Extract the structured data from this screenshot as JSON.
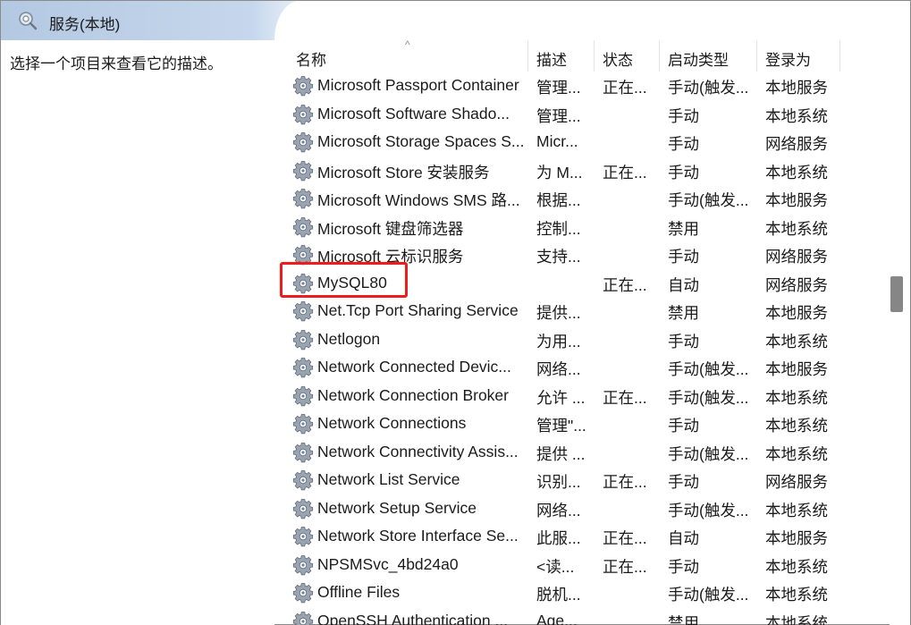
{
  "window": {
    "title": "服务(本地)",
    "title_icon": "services-icon"
  },
  "left_pane": {
    "description_hint": "选择一个项目来查看它的描述。"
  },
  "columns": {
    "name": "名称",
    "description": "描述",
    "status": "状态",
    "startup_type": "启动类型",
    "logon_as": "登录为"
  },
  "services": [
    {
      "name": "Microsoft Passport Container",
      "description": "管理...",
      "status": "正在...",
      "startup_type": "手动(触发...",
      "logon_as": "本地服务"
    },
    {
      "name": "Microsoft Software Shado...",
      "description": "管理...",
      "status": "",
      "startup_type": "手动",
      "logon_as": "本地系统"
    },
    {
      "name": "Microsoft Storage Spaces S...",
      "description": "Micr...",
      "status": "",
      "startup_type": "手动",
      "logon_as": "网络服务"
    },
    {
      "name": "Microsoft Store 安装服务",
      "description": "为 M...",
      "status": "正在...",
      "startup_type": "手动",
      "logon_as": "本地系统"
    },
    {
      "name": "Microsoft Windows SMS 路...",
      "description": "根据...",
      "status": "",
      "startup_type": "手动(触发...",
      "logon_as": "本地服务"
    },
    {
      "name": "Microsoft 键盘筛选器",
      "description": "控制...",
      "status": "",
      "startup_type": "禁用",
      "logon_as": "本地系统"
    },
    {
      "name": "Microsoft 云标识服务",
      "description": "支持...",
      "status": "",
      "startup_type": "手动",
      "logon_as": "网络服务"
    },
    {
      "name": "MySQL80",
      "description": "",
      "status": "正在...",
      "startup_type": "自动",
      "logon_as": "网络服务"
    },
    {
      "name": "Net.Tcp Port Sharing Service",
      "description": "提供...",
      "status": "",
      "startup_type": "禁用",
      "logon_as": "本地服务"
    },
    {
      "name": "Netlogon",
      "description": "为用...",
      "status": "",
      "startup_type": "手动",
      "logon_as": "本地系统"
    },
    {
      "name": "Network Connected Devic...",
      "description": "网络...",
      "status": "",
      "startup_type": "手动(触发...",
      "logon_as": "本地服务"
    },
    {
      "name": "Network Connection Broker",
      "description": "允许 ...",
      "status": "正在...",
      "startup_type": "手动(触发...",
      "logon_as": "本地系统"
    },
    {
      "name": "Network Connections",
      "description": "管理\"...",
      "status": "",
      "startup_type": "手动",
      "logon_as": "本地系统"
    },
    {
      "name": "Network Connectivity Assis...",
      "description": "提供 ...",
      "status": "",
      "startup_type": "手动(触发...",
      "logon_as": "本地系统"
    },
    {
      "name": "Network List Service",
      "description": "识别...",
      "status": "正在...",
      "startup_type": "手动",
      "logon_as": "网络服务"
    },
    {
      "name": "Network Setup Service",
      "description": "网络...",
      "status": "",
      "startup_type": "手动(触发...",
      "logon_as": "本地系统"
    },
    {
      "name": "Network Store Interface Se...",
      "description": "此服...",
      "status": "正在...",
      "startup_type": "自动",
      "logon_as": "本地服务"
    },
    {
      "name": "NPSMSvc_4bd24a0",
      "description": "<读...",
      "status": "正在...",
      "startup_type": "手动",
      "logon_as": "本地系统"
    },
    {
      "name": "Offline Files",
      "description": "脱机...",
      "status": "",
      "startup_type": "手动(触发...",
      "logon_as": "本地系统"
    },
    {
      "name": "OpenSSH Authentication ...",
      "description": "Age...",
      "status": "",
      "startup_type": "禁用",
      "logon_as": "本地系统"
    }
  ],
  "highlighted_service": "MySQL80",
  "colors": {
    "header_band": "#b7cbe3",
    "highlight_border": "#ee1c1c",
    "scroll_thumb": "#868686"
  }
}
